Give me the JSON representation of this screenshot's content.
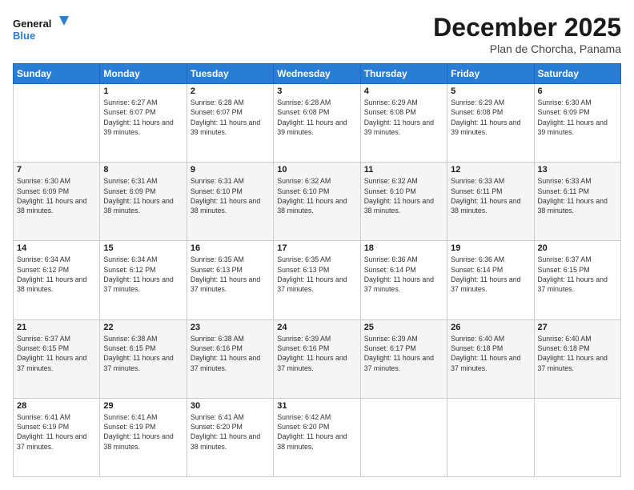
{
  "logo": {
    "line1": "General",
    "line2": "Blue"
  },
  "title": "December 2025",
  "subtitle": "Plan de Chorcha, Panama",
  "days_of_week": [
    "Sunday",
    "Monday",
    "Tuesday",
    "Wednesday",
    "Thursday",
    "Friday",
    "Saturday"
  ],
  "weeks": [
    [
      {
        "day": "",
        "sunrise": "",
        "sunset": "",
        "daylight": ""
      },
      {
        "day": "1",
        "sunrise": "Sunrise: 6:27 AM",
        "sunset": "Sunset: 6:07 PM",
        "daylight": "Daylight: 11 hours and 39 minutes."
      },
      {
        "day": "2",
        "sunrise": "Sunrise: 6:28 AM",
        "sunset": "Sunset: 6:07 PM",
        "daylight": "Daylight: 11 hours and 39 minutes."
      },
      {
        "day": "3",
        "sunrise": "Sunrise: 6:28 AM",
        "sunset": "Sunset: 6:08 PM",
        "daylight": "Daylight: 11 hours and 39 minutes."
      },
      {
        "day": "4",
        "sunrise": "Sunrise: 6:29 AM",
        "sunset": "Sunset: 6:08 PM",
        "daylight": "Daylight: 11 hours and 39 minutes."
      },
      {
        "day": "5",
        "sunrise": "Sunrise: 6:29 AM",
        "sunset": "Sunset: 6:08 PM",
        "daylight": "Daylight: 11 hours and 39 minutes."
      },
      {
        "day": "6",
        "sunrise": "Sunrise: 6:30 AM",
        "sunset": "Sunset: 6:09 PM",
        "daylight": "Daylight: 11 hours and 39 minutes."
      }
    ],
    [
      {
        "day": "7",
        "sunrise": "Sunrise: 6:30 AM",
        "sunset": "Sunset: 6:09 PM",
        "daylight": "Daylight: 11 hours and 38 minutes."
      },
      {
        "day": "8",
        "sunrise": "Sunrise: 6:31 AM",
        "sunset": "Sunset: 6:09 PM",
        "daylight": "Daylight: 11 hours and 38 minutes."
      },
      {
        "day": "9",
        "sunrise": "Sunrise: 6:31 AM",
        "sunset": "Sunset: 6:10 PM",
        "daylight": "Daylight: 11 hours and 38 minutes."
      },
      {
        "day": "10",
        "sunrise": "Sunrise: 6:32 AM",
        "sunset": "Sunset: 6:10 PM",
        "daylight": "Daylight: 11 hours and 38 minutes."
      },
      {
        "day": "11",
        "sunrise": "Sunrise: 6:32 AM",
        "sunset": "Sunset: 6:10 PM",
        "daylight": "Daylight: 11 hours and 38 minutes."
      },
      {
        "day": "12",
        "sunrise": "Sunrise: 6:33 AM",
        "sunset": "Sunset: 6:11 PM",
        "daylight": "Daylight: 11 hours and 38 minutes."
      },
      {
        "day": "13",
        "sunrise": "Sunrise: 6:33 AM",
        "sunset": "Sunset: 6:11 PM",
        "daylight": "Daylight: 11 hours and 38 minutes."
      }
    ],
    [
      {
        "day": "14",
        "sunrise": "Sunrise: 6:34 AM",
        "sunset": "Sunset: 6:12 PM",
        "daylight": "Daylight: 11 hours and 38 minutes."
      },
      {
        "day": "15",
        "sunrise": "Sunrise: 6:34 AM",
        "sunset": "Sunset: 6:12 PM",
        "daylight": "Daylight: 11 hours and 37 minutes."
      },
      {
        "day": "16",
        "sunrise": "Sunrise: 6:35 AM",
        "sunset": "Sunset: 6:13 PM",
        "daylight": "Daylight: 11 hours and 37 minutes."
      },
      {
        "day": "17",
        "sunrise": "Sunrise: 6:35 AM",
        "sunset": "Sunset: 6:13 PM",
        "daylight": "Daylight: 11 hours and 37 minutes."
      },
      {
        "day": "18",
        "sunrise": "Sunrise: 6:36 AM",
        "sunset": "Sunset: 6:14 PM",
        "daylight": "Daylight: 11 hours and 37 minutes."
      },
      {
        "day": "19",
        "sunrise": "Sunrise: 6:36 AM",
        "sunset": "Sunset: 6:14 PM",
        "daylight": "Daylight: 11 hours and 37 minutes."
      },
      {
        "day": "20",
        "sunrise": "Sunrise: 6:37 AM",
        "sunset": "Sunset: 6:15 PM",
        "daylight": "Daylight: 11 hours and 37 minutes."
      }
    ],
    [
      {
        "day": "21",
        "sunrise": "Sunrise: 6:37 AM",
        "sunset": "Sunset: 6:15 PM",
        "daylight": "Daylight: 11 hours and 37 minutes."
      },
      {
        "day": "22",
        "sunrise": "Sunrise: 6:38 AM",
        "sunset": "Sunset: 6:15 PM",
        "daylight": "Daylight: 11 hours and 37 minutes."
      },
      {
        "day": "23",
        "sunrise": "Sunrise: 6:38 AM",
        "sunset": "Sunset: 6:16 PM",
        "daylight": "Daylight: 11 hours and 37 minutes."
      },
      {
        "day": "24",
        "sunrise": "Sunrise: 6:39 AM",
        "sunset": "Sunset: 6:16 PM",
        "daylight": "Daylight: 11 hours and 37 minutes."
      },
      {
        "day": "25",
        "sunrise": "Sunrise: 6:39 AM",
        "sunset": "Sunset: 6:17 PM",
        "daylight": "Daylight: 11 hours and 37 minutes."
      },
      {
        "day": "26",
        "sunrise": "Sunrise: 6:40 AM",
        "sunset": "Sunset: 6:18 PM",
        "daylight": "Daylight: 11 hours and 37 minutes."
      },
      {
        "day": "27",
        "sunrise": "Sunrise: 6:40 AM",
        "sunset": "Sunset: 6:18 PM",
        "daylight": "Daylight: 11 hours and 37 minutes."
      }
    ],
    [
      {
        "day": "28",
        "sunrise": "Sunrise: 6:41 AM",
        "sunset": "Sunset: 6:19 PM",
        "daylight": "Daylight: 11 hours and 37 minutes."
      },
      {
        "day": "29",
        "sunrise": "Sunrise: 6:41 AM",
        "sunset": "Sunset: 6:19 PM",
        "daylight": "Daylight: 11 hours and 38 minutes."
      },
      {
        "day": "30",
        "sunrise": "Sunrise: 6:41 AM",
        "sunset": "Sunset: 6:20 PM",
        "daylight": "Daylight: 11 hours and 38 minutes."
      },
      {
        "day": "31",
        "sunrise": "Sunrise: 6:42 AM",
        "sunset": "Sunset: 6:20 PM",
        "daylight": "Daylight: 11 hours and 38 minutes."
      },
      {
        "day": "",
        "sunrise": "",
        "sunset": "",
        "daylight": ""
      },
      {
        "day": "",
        "sunrise": "",
        "sunset": "",
        "daylight": ""
      },
      {
        "day": "",
        "sunrise": "",
        "sunset": "",
        "daylight": ""
      }
    ]
  ]
}
